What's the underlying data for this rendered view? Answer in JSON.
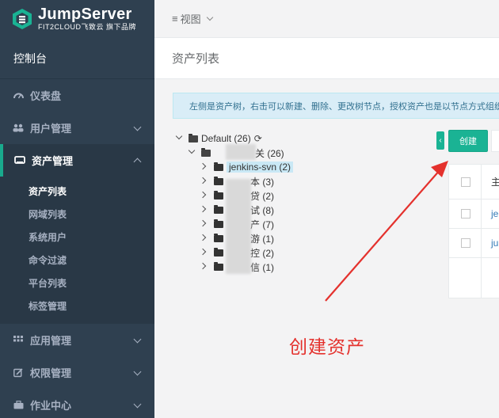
{
  "brand": {
    "title": "JumpServer",
    "subtitle": "FIT2CLOUD飞致云 旗下品牌",
    "accent": "#1ab394",
    "sidebar_bg": "#2f4050"
  },
  "sidebar": {
    "console_label": "控制台",
    "items": [
      {
        "label": "仪表盘",
        "icon": "dashboard-icon"
      },
      {
        "label": "用户管理",
        "icon": "users-icon"
      },
      {
        "label": "资产管理",
        "icon": "assets-icon"
      },
      {
        "label": "应用管理",
        "icon": "apps-icon"
      },
      {
        "label": "权限管理",
        "icon": "permissions-icon"
      },
      {
        "label": "作业中心",
        "icon": "jobs-icon"
      }
    ],
    "asset_sub_items": [
      {
        "label": "资产列表"
      },
      {
        "label": "网域列表"
      },
      {
        "label": "系统用户"
      },
      {
        "label": "命令过滤"
      },
      {
        "label": "平台列表"
      },
      {
        "label": "标签管理"
      }
    ]
  },
  "topbar": {
    "view_label": "视图"
  },
  "page": {
    "title": "资产列表",
    "info_text": "左侧是资产树，右击可以新建、删除、更改树节点，授权资产也是以节点方式组织"
  },
  "tree": {
    "root_label": "Default (26)",
    "level1_label": "关 (26)",
    "children": [
      {
        "label": "jenkins-svn (2)"
      },
      {
        "label": "本 (3)"
      },
      {
        "label": "贷 (2)"
      },
      {
        "label": "试 (8)"
      },
      {
        "label": "产 (7)"
      },
      {
        "label": "游 (1)"
      },
      {
        "label": "控 (2)"
      },
      {
        "label": "信 (1)"
      }
    ]
  },
  "toolbar": {
    "collapse_label": "‹",
    "create_label": "创建"
  },
  "table": {
    "header_col": "主",
    "rows": [
      {
        "name": "je"
      },
      {
        "name": "ju"
      }
    ]
  },
  "annotation": {
    "text": "创建资产",
    "color": "#e4312d"
  }
}
